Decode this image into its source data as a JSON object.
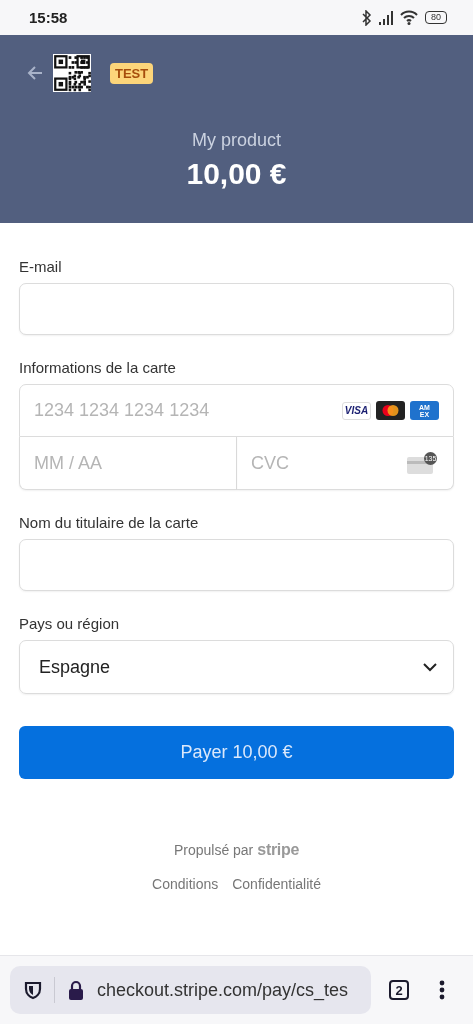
{
  "status_bar": {
    "time": "15:58",
    "battery": "80"
  },
  "header": {
    "badge": "TEST",
    "product": "My product",
    "price": "10,00 €"
  },
  "form": {
    "fields": [
      {
        "kind": "text",
        "label": "E-mail"
      },
      {
        "kind": "card",
        "label": "Informations de la carte",
        "number_placeholder": "1234 1234 1234 1234",
        "brands": [
          {
            "kind": "visa",
            "text": "VISA"
          },
          {
            "kind": "mastercard"
          },
          {
            "kind": "amex",
            "text": "AMEX"
          }
        ],
        "expiry_placeholder": "MM / AA",
        "cvc_placeholder": "CVC",
        "cvc_icon_text": "135"
      },
      {
        "kind": "text",
        "label": "Nom du titulaire de la carte"
      },
      {
        "kind": "select",
        "label": "Pays ou région",
        "value": "Espagne"
      }
    ],
    "pay_button": "Payer 10,00 €"
  },
  "footer": {
    "powered_by": "Propulsé par",
    "brand": "stripe",
    "links": [
      "Conditions",
      "Confidentialité"
    ]
  },
  "browser": {
    "url": "checkout.stripe.com/pay/cs_tes",
    "tab_count": "2"
  }
}
